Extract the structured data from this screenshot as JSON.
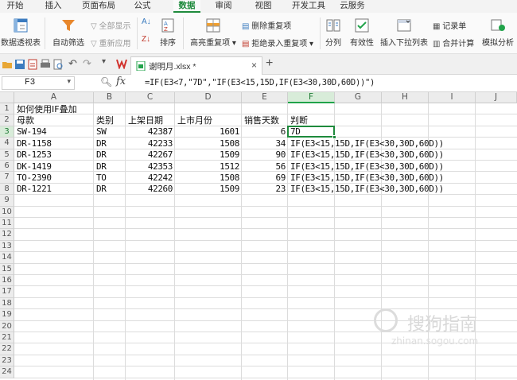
{
  "menu": {
    "tabs": [
      "开始",
      "插入",
      "页面布局",
      "公式",
      "数据",
      "审阅",
      "视图",
      "开发工具",
      "云服务"
    ],
    "active_index": 4
  },
  "ribbon": {
    "pivot": "数据透视表",
    "autofilter": "自动筛选",
    "show_all": "全部显示",
    "reapply": "重新应用",
    "sort": "排序",
    "highlight_dup": "高亮重复项",
    "remove_dup": "删除重复项",
    "reject_dup": "拒绝录入重复项",
    "split": "分列",
    "validity": "有效性",
    "insert_dropdown": "插入下拉列表",
    "record": "记录单",
    "merge_calc": "合并计算",
    "sim_analysis": "模拟分析"
  },
  "document": {
    "tab_name": "谢明月.xlsx *"
  },
  "formula_bar": {
    "name_box": "F3",
    "formula": "=IF(E3<7,\"7D\",\"IF(E3<15,15D,IF(E3<30,30D,60D))\")"
  },
  "sheet": {
    "columns": [
      "A",
      "B",
      "C",
      "D",
      "E",
      "F",
      "G",
      "H",
      "I",
      "J"
    ],
    "rows": [
      "1",
      "2",
      "3",
      "4",
      "5",
      "6",
      "7",
      "8",
      "9",
      "10",
      "11",
      "12",
      "13",
      "14",
      "15",
      "16",
      "17",
      "18",
      "19",
      "20",
      "21",
      "22",
      "23",
      "24"
    ],
    "title": "如何使用IF叠加",
    "headers": [
      "母款",
      "类别",
      "上架日期",
      "上市月份",
      "销售天数",
      "判断"
    ],
    "data": [
      [
        "SW-194",
        "SW",
        "42387",
        "1601",
        "6",
        "7D"
      ],
      [
        "DR-1158",
        "DR",
        "42233",
        "1508",
        "34",
        "IF(E3<15,15D,IF(E3<30,30D,60D))"
      ],
      [
        "DR-1253",
        "DR",
        "42267",
        "1509",
        "90",
        "IF(E3<15,15D,IF(E3<30,30D,60D))"
      ],
      [
        "DK-1419",
        "DR",
        "42353",
        "1512",
        "56",
        "IF(E3<15,15D,IF(E3<30,30D,60D))"
      ],
      [
        "TO-2390",
        "TO",
        "42242",
        "1508",
        "69",
        "IF(E3<15,15D,IF(E3<30,30D,60D))"
      ],
      [
        "DR-1221",
        "DR",
        "42260",
        "1509",
        "23",
        "IF(E3<15,15D,IF(E3<30,30D,60D))"
      ]
    ]
  },
  "watermark": {
    "text": "搜狗指南",
    "url": "zhinan.sogou.com"
  }
}
